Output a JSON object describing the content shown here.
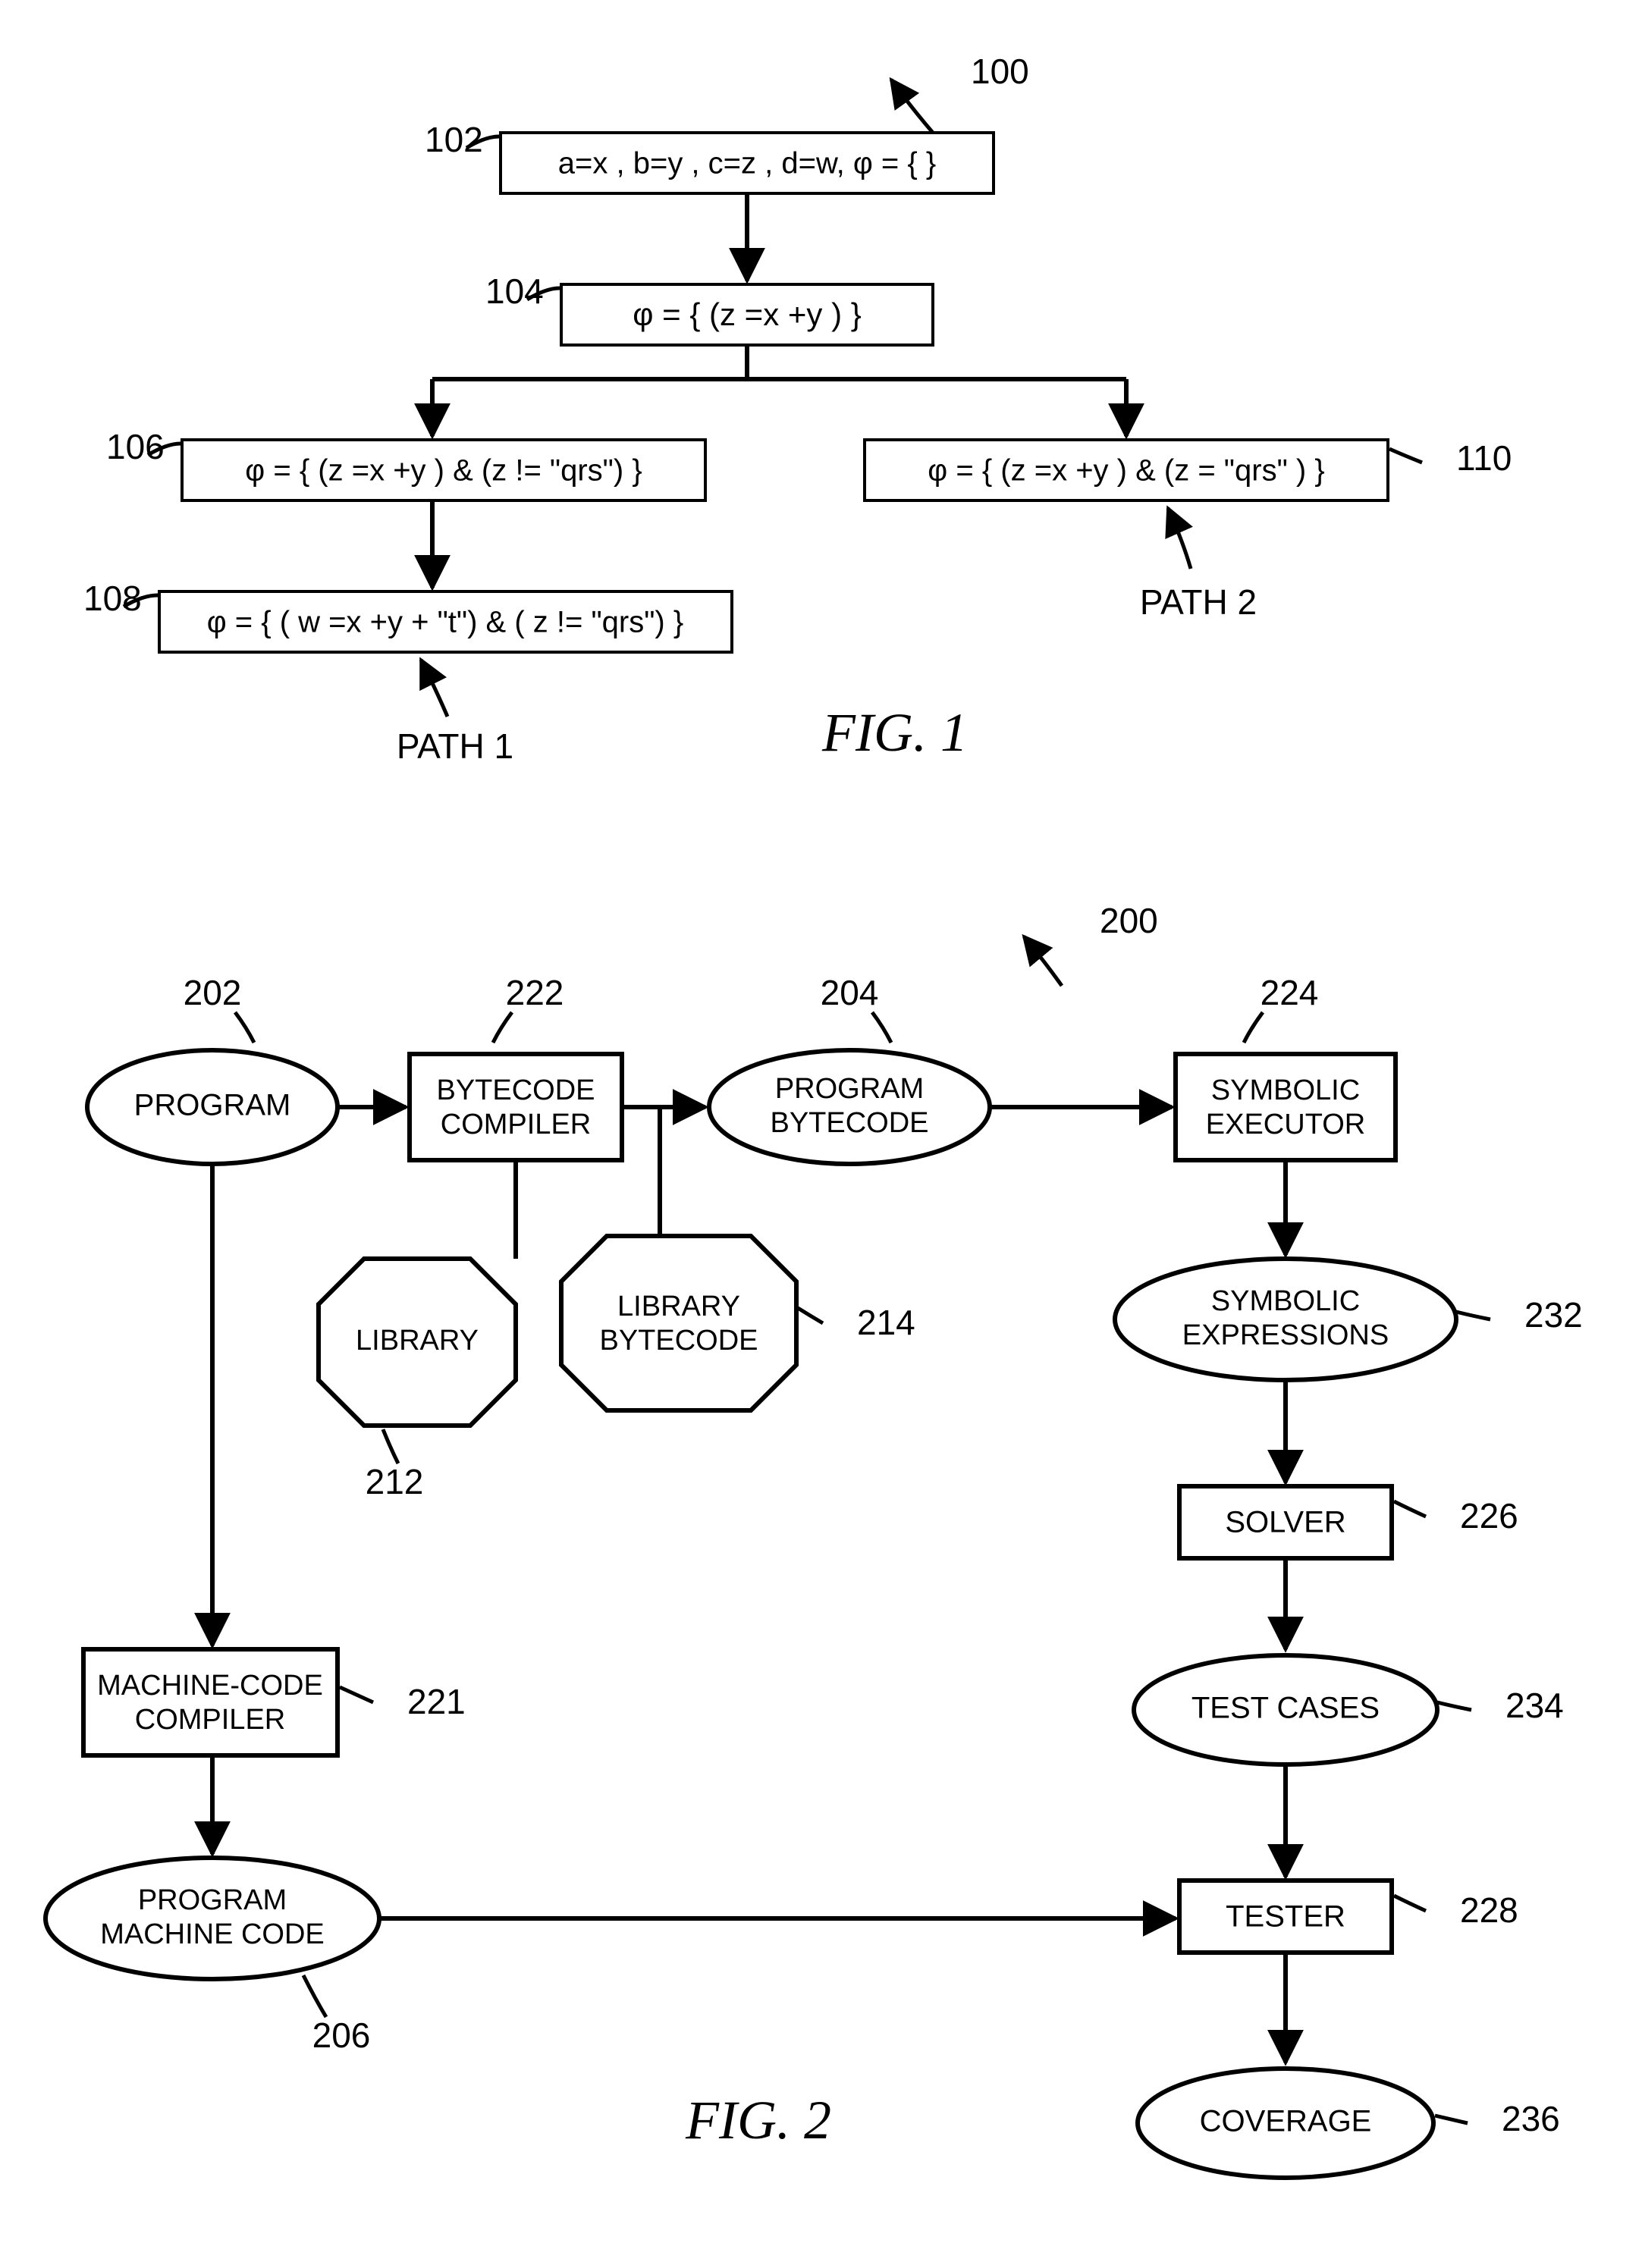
{
  "fig1": {
    "title": "FIG. 1",
    "ref": "100",
    "nodes": {
      "n102": {
        "num": "102",
        "text": "a=x , b=y , c=z , d=w,  φ = { }"
      },
      "n104": {
        "num": "104",
        "text": "φ = {  (z =x +y )  }"
      },
      "n106": {
        "num": "106",
        "text": "φ = {  (z =x +y )  &  (z != \"qrs\") }"
      },
      "n108": {
        "num": "108",
        "text": "φ = {  ( w =x +y + \"t\")  &  ( z != \"qrs\") }"
      },
      "n110": {
        "num": "110",
        "text": "φ = {  (z =x +y )  &  (z = \"qrs\" )  }"
      }
    },
    "paths": {
      "p1": "PATH 1",
      "p2": "PATH 2"
    }
  },
  "fig2": {
    "title": "FIG. 2",
    "ref": "200",
    "nodes": {
      "n202": {
        "num": "202",
        "text": "PROGRAM"
      },
      "n204": {
        "num": "204",
        "text": "PROGRAM\nBYTECODE"
      },
      "n206": {
        "num": "206",
        "text": "PROGRAM\nMACHINE CODE"
      },
      "n212": {
        "num": "212",
        "text": "LIBRARY"
      },
      "n214": {
        "num": "214",
        "text": "LIBRARY\nBYTECODE"
      },
      "n221": {
        "num": "221",
        "text": "MACHINE-CODE\nCOMPILER"
      },
      "n222": {
        "num": "222",
        "text": "BYTECODE\nCOMPILER"
      },
      "n224": {
        "num": "224",
        "text": "SYMBOLIC\nEXECUTOR"
      },
      "n226": {
        "num": "226",
        "text": "SOLVER"
      },
      "n228": {
        "num": "228",
        "text": "TESTER"
      },
      "n232": {
        "num": "232",
        "text": "SYMBOLIC\nEXPRESSIONS"
      },
      "n234": {
        "num": "234",
        "text": "TEST CASES"
      },
      "n236": {
        "num": "236",
        "text": "COVERAGE"
      }
    }
  }
}
